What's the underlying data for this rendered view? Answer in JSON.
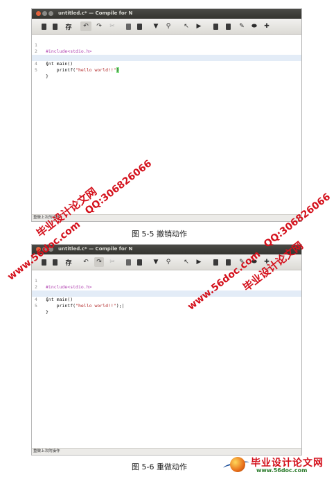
{
  "windows": [
    {
      "title": "untitled.c* — Compile for N",
      "status": "重做上次的操作",
      "cursor_line": 4,
      "lines": [
        {
          "n": "1",
          "pp": "#include<stdio.h>"
        },
        {
          "n": "2",
          "code": "int main()",
          "fold": true
        },
        {
          "n": "3",
          "code": "{"
        },
        {
          "n": "4",
          "pre": "    printf(",
          "str": "\"hello world!!\"",
          "post": ")",
          "mark": "brace"
        },
        {
          "n": "5",
          "code": "}"
        }
      ]
    },
    {
      "title": "untitled.c* — Compile for N",
      "status": "重做上次的操作",
      "cursor_line": 4,
      "lines": [
        {
          "n": "1",
          "pp": "#include<stdio.h>"
        },
        {
          "n": "2",
          "code": "int main()",
          "fold": true
        },
        {
          "n": "3",
          "code": "{"
        },
        {
          "n": "4",
          "pre": "    printf(",
          "str": "\"hello world!!\"",
          "post": ");|"
        },
        {
          "n": "5",
          "code": "}"
        }
      ]
    }
  ],
  "toolbar": {
    "save_label": "存",
    "icons": [
      "new-file-icon",
      "open-file-icon",
      "save-icon",
      "undo-icon",
      "redo-icon",
      "cut-icon",
      "copy-icon",
      "paste-icon",
      "find-icon",
      "replace-icon",
      "build-icon",
      "run-icon",
      "stop-icon",
      "debug-icon",
      "comment-icon",
      "settings-icon",
      "help-icon"
    ]
  },
  "captions": {
    "fig1": "图 5-5  撤销动作",
    "fig2": "图 5-6  重做动作"
  },
  "watermarks": {
    "site": "www.56doc.com",
    "qq": "QQ:306826066",
    "cn": "毕业设计论文网"
  },
  "logo": {
    "cn": "毕业设计论文网",
    "en": "www.56doc.com"
  },
  "colors": {
    "titlebar": "#3c3b37",
    "close": "#e2623c",
    "watermark_red": "#d4111c",
    "current_line": "#e3ecf7",
    "string": "#b32b2b",
    "preprocessor": "#b041b0"
  }
}
